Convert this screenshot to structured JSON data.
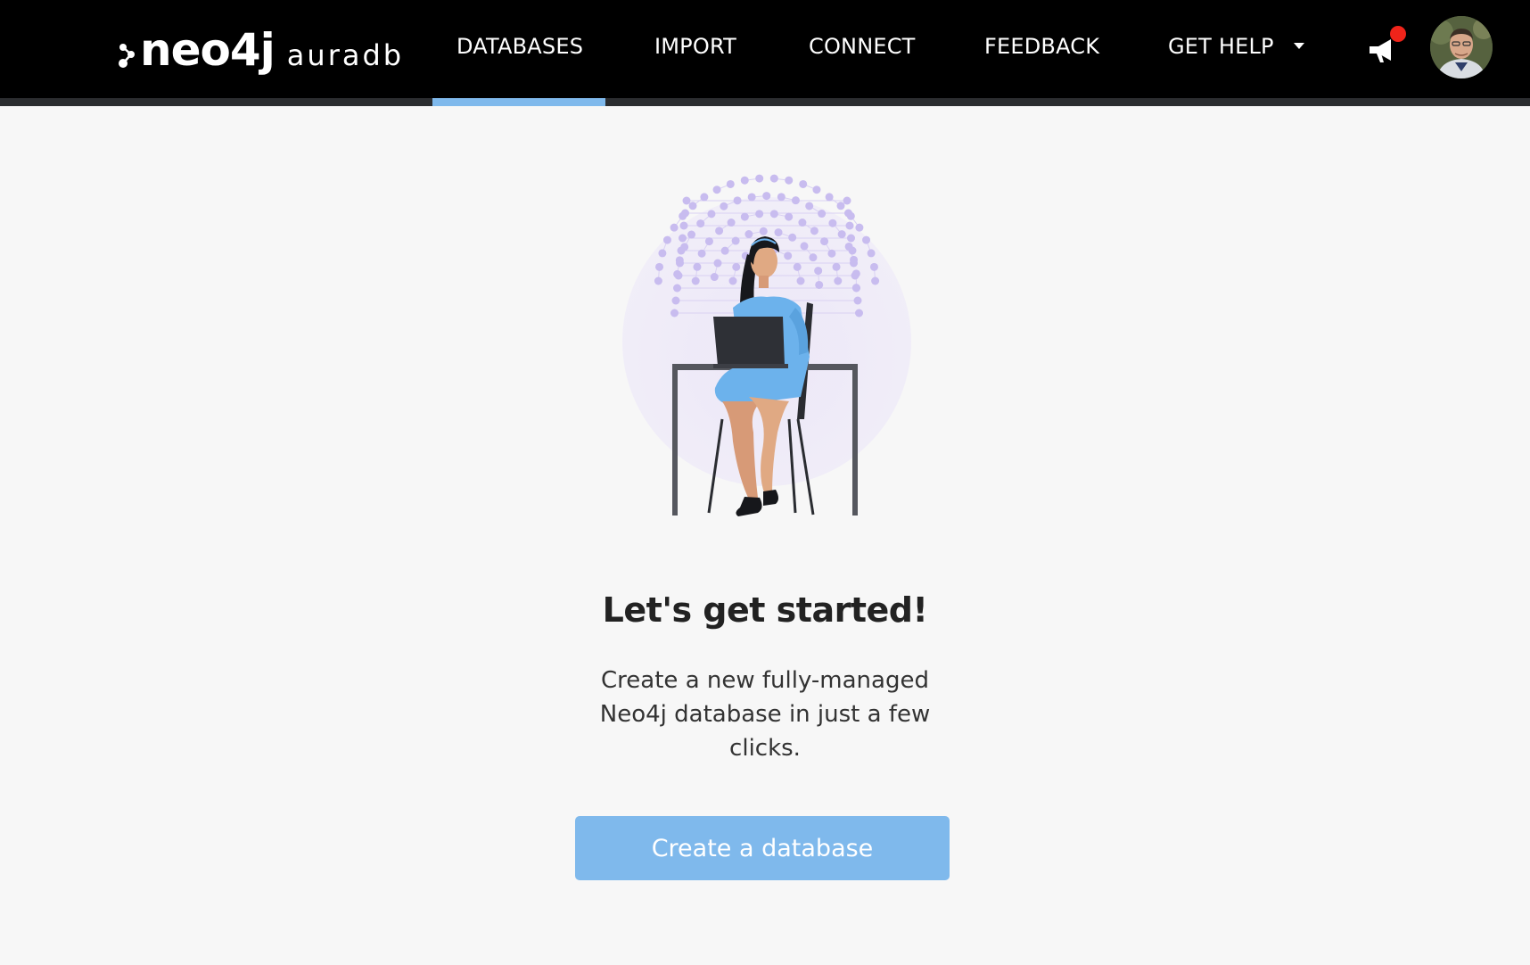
{
  "app": {
    "brand_word": "neo4j",
    "brand_product": "auradb"
  },
  "nav": {
    "items": [
      {
        "label": "DATABASES",
        "active": true
      },
      {
        "label": "IMPORT",
        "active": false
      },
      {
        "label": "CONNECT",
        "active": false
      },
      {
        "label": "FEEDBACK",
        "active": false
      },
      {
        "label": "GET HELP",
        "active": false
      }
    ],
    "announcements_icon": "megaphone-icon",
    "notification_dot": true,
    "avatar": "user-avatar"
  },
  "main": {
    "headline": "Let's get started!",
    "description": "Create a new fully-managed Neo4j database in just a few clicks.",
    "cta_label": "Create a database",
    "illustration": "woman-at-laptop-graph-illustration"
  },
  "colors": {
    "topbar": "#000000",
    "accent": "#7fb9ec",
    "notification": "#f0241a",
    "background": "#f7f7f7"
  }
}
